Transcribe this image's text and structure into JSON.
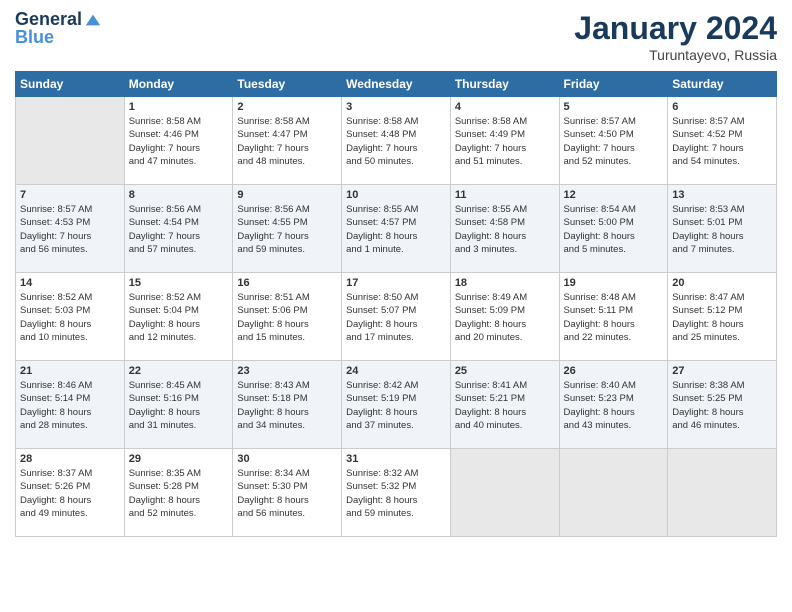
{
  "header": {
    "logo_line1": "General",
    "logo_line2": "Blue",
    "month": "January 2024",
    "location": "Turuntayevo, Russia"
  },
  "days_of_week": [
    "Sunday",
    "Monday",
    "Tuesday",
    "Wednesday",
    "Thursday",
    "Friday",
    "Saturday"
  ],
  "weeks": [
    [
      {
        "num": "",
        "info": ""
      },
      {
        "num": "1",
        "info": "Sunrise: 8:58 AM\nSunset: 4:46 PM\nDaylight: 7 hours\nand 47 minutes."
      },
      {
        "num": "2",
        "info": "Sunrise: 8:58 AM\nSunset: 4:47 PM\nDaylight: 7 hours\nand 48 minutes."
      },
      {
        "num": "3",
        "info": "Sunrise: 8:58 AM\nSunset: 4:48 PM\nDaylight: 7 hours\nand 50 minutes."
      },
      {
        "num": "4",
        "info": "Sunrise: 8:58 AM\nSunset: 4:49 PM\nDaylight: 7 hours\nand 51 minutes."
      },
      {
        "num": "5",
        "info": "Sunrise: 8:57 AM\nSunset: 4:50 PM\nDaylight: 7 hours\nand 52 minutes."
      },
      {
        "num": "6",
        "info": "Sunrise: 8:57 AM\nSunset: 4:52 PM\nDaylight: 7 hours\nand 54 minutes."
      }
    ],
    [
      {
        "num": "7",
        "info": "Sunrise: 8:57 AM\nSunset: 4:53 PM\nDaylight: 7 hours\nand 56 minutes."
      },
      {
        "num": "8",
        "info": "Sunrise: 8:56 AM\nSunset: 4:54 PM\nDaylight: 7 hours\nand 57 minutes."
      },
      {
        "num": "9",
        "info": "Sunrise: 8:56 AM\nSunset: 4:55 PM\nDaylight: 7 hours\nand 59 minutes."
      },
      {
        "num": "10",
        "info": "Sunrise: 8:55 AM\nSunset: 4:57 PM\nDaylight: 8 hours\nand 1 minute."
      },
      {
        "num": "11",
        "info": "Sunrise: 8:55 AM\nSunset: 4:58 PM\nDaylight: 8 hours\nand 3 minutes."
      },
      {
        "num": "12",
        "info": "Sunrise: 8:54 AM\nSunset: 5:00 PM\nDaylight: 8 hours\nand 5 minutes."
      },
      {
        "num": "13",
        "info": "Sunrise: 8:53 AM\nSunset: 5:01 PM\nDaylight: 8 hours\nand 7 minutes."
      }
    ],
    [
      {
        "num": "14",
        "info": "Sunrise: 8:52 AM\nSunset: 5:03 PM\nDaylight: 8 hours\nand 10 minutes."
      },
      {
        "num": "15",
        "info": "Sunrise: 8:52 AM\nSunset: 5:04 PM\nDaylight: 8 hours\nand 12 minutes."
      },
      {
        "num": "16",
        "info": "Sunrise: 8:51 AM\nSunset: 5:06 PM\nDaylight: 8 hours\nand 15 minutes."
      },
      {
        "num": "17",
        "info": "Sunrise: 8:50 AM\nSunset: 5:07 PM\nDaylight: 8 hours\nand 17 minutes."
      },
      {
        "num": "18",
        "info": "Sunrise: 8:49 AM\nSunset: 5:09 PM\nDaylight: 8 hours\nand 20 minutes."
      },
      {
        "num": "19",
        "info": "Sunrise: 8:48 AM\nSunset: 5:11 PM\nDaylight: 8 hours\nand 22 minutes."
      },
      {
        "num": "20",
        "info": "Sunrise: 8:47 AM\nSunset: 5:12 PM\nDaylight: 8 hours\nand 25 minutes."
      }
    ],
    [
      {
        "num": "21",
        "info": "Sunrise: 8:46 AM\nSunset: 5:14 PM\nDaylight: 8 hours\nand 28 minutes."
      },
      {
        "num": "22",
        "info": "Sunrise: 8:45 AM\nSunset: 5:16 PM\nDaylight: 8 hours\nand 31 minutes."
      },
      {
        "num": "23",
        "info": "Sunrise: 8:43 AM\nSunset: 5:18 PM\nDaylight: 8 hours\nand 34 minutes."
      },
      {
        "num": "24",
        "info": "Sunrise: 8:42 AM\nSunset: 5:19 PM\nDaylight: 8 hours\nand 37 minutes."
      },
      {
        "num": "25",
        "info": "Sunrise: 8:41 AM\nSunset: 5:21 PM\nDaylight: 8 hours\nand 40 minutes."
      },
      {
        "num": "26",
        "info": "Sunrise: 8:40 AM\nSunset: 5:23 PM\nDaylight: 8 hours\nand 43 minutes."
      },
      {
        "num": "27",
        "info": "Sunrise: 8:38 AM\nSunset: 5:25 PM\nDaylight: 8 hours\nand 46 minutes."
      }
    ],
    [
      {
        "num": "28",
        "info": "Sunrise: 8:37 AM\nSunset: 5:26 PM\nDaylight: 8 hours\nand 49 minutes."
      },
      {
        "num": "29",
        "info": "Sunrise: 8:35 AM\nSunset: 5:28 PM\nDaylight: 8 hours\nand 52 minutes."
      },
      {
        "num": "30",
        "info": "Sunrise: 8:34 AM\nSunset: 5:30 PM\nDaylight: 8 hours\nand 56 minutes."
      },
      {
        "num": "31",
        "info": "Sunrise: 8:32 AM\nSunset: 5:32 PM\nDaylight: 8 hours\nand 59 minutes."
      },
      {
        "num": "",
        "info": ""
      },
      {
        "num": "",
        "info": ""
      },
      {
        "num": "",
        "info": ""
      }
    ]
  ]
}
